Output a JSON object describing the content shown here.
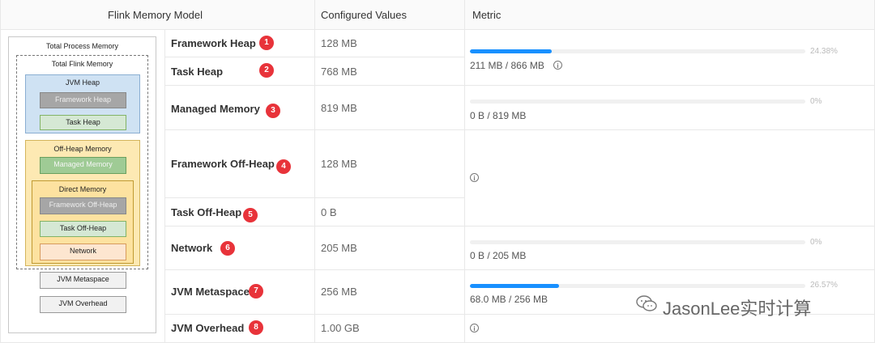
{
  "headers": {
    "model": "Flink Memory Model",
    "configured": "Configured Values",
    "metric": "Metric"
  },
  "diagram": {
    "total_process": "Total Process Memory",
    "total_flink": "Total Flink Memory",
    "jvm_heap": "JVM Heap",
    "framework_heap": "Framework Heap",
    "task_heap": "Task Heap",
    "off_heap": "Off-Heap Memory",
    "managed": "Managed Memory",
    "direct": "Direct Memory",
    "framework_off_heap": "Framework Off-Heap",
    "task_off_heap": "Task Off-Heap",
    "network": "Network",
    "jvm_metaspace": "JVM Metaspace",
    "jvm_overhead": "JVM Overhead"
  },
  "rows": [
    {
      "label": "Framework Heap",
      "badge": "1",
      "value": "128 MB"
    },
    {
      "label": "Task Heap",
      "badge": "2",
      "value": "768 MB"
    },
    {
      "label": "Managed Memory",
      "badge": "3",
      "value": "819 MB"
    },
    {
      "label": "Framework Off-Heap",
      "badge": "4",
      "value": "128 MB"
    },
    {
      "label": "Task Off-Heap",
      "badge": "5",
      "value": "0 B"
    },
    {
      "label": "Network",
      "badge": "6",
      "value": "205 MB"
    },
    {
      "label": "JVM Metaspace",
      "badge": "7",
      "value": "256 MB"
    },
    {
      "label": "JVM Overhead",
      "badge": "8",
      "value": "1.00 GB"
    }
  ],
  "metrics": [
    {
      "percent": 24.38,
      "percent_label": "24.38%",
      "used": "211 MB / 866 MB",
      "info": true
    },
    {
      "percent": 0,
      "percent_label": "0%",
      "used": "0 B / 819 MB",
      "info": false
    },
    {
      "percent": 0,
      "percent_label": "0%",
      "used": "0 B / 205 MB",
      "info": false
    },
    {
      "percent": 26.57,
      "percent_label": "26.57%",
      "used": "68.0 MB / 256 MB",
      "info": false
    }
  ],
  "info_icon_glyph": "i",
  "watermark": "JasonLee实时计算",
  "colors": {
    "bar_fill": "#1890ff",
    "badge": "#e8333a",
    "border": "#e8e8e8"
  }
}
